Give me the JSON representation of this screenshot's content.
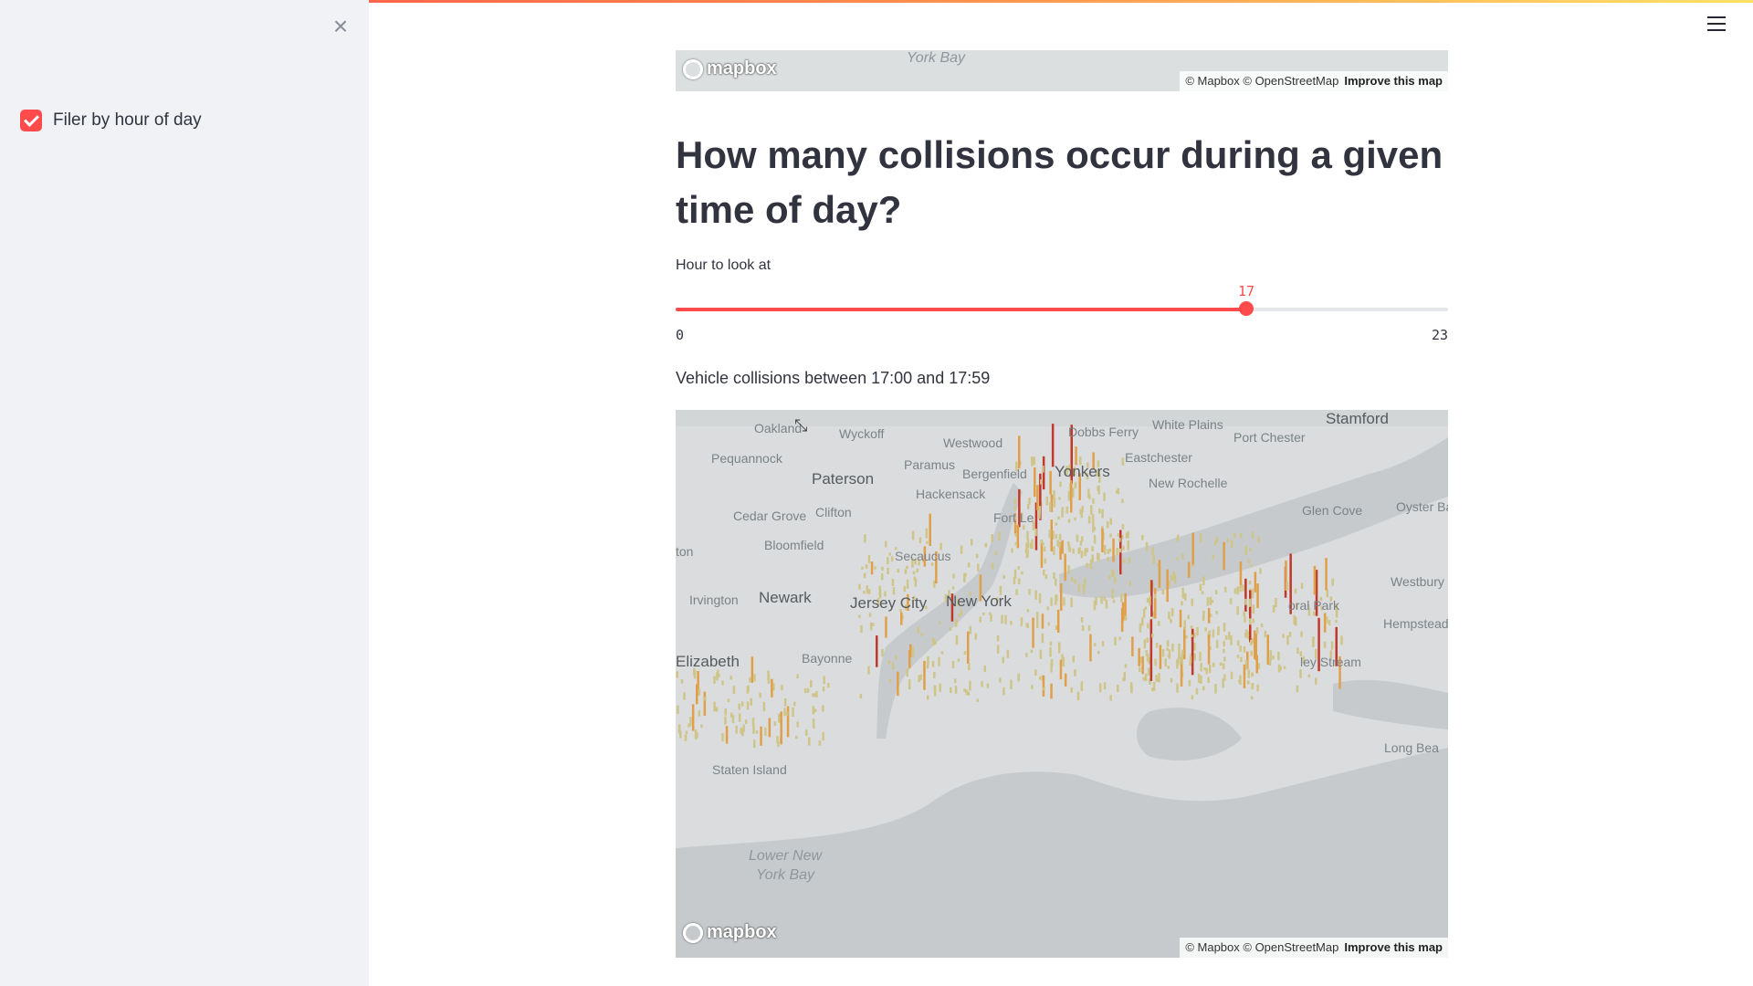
{
  "sidebar": {
    "close_icon": "×",
    "filter_checkbox": {
      "label": "Filer by hour of day",
      "checked": true
    }
  },
  "header": {
    "menu_icon": "hamburger-icon"
  },
  "top_map": {
    "bay_label": "York Bay",
    "logo": "mapbox",
    "attribution": "© Mapbox © OpenStreetMap",
    "improve": "Improve this map"
  },
  "main": {
    "title": "How many collisions occur during a given time of day?",
    "slider": {
      "label": "Hour to look at",
      "value": 17,
      "min": 0,
      "max": 23,
      "value_text": "17",
      "min_text": "0",
      "max_text": "23"
    },
    "caption": "Vehicle collisions between 17:00 and 17:59"
  },
  "map": {
    "logo": "mapbox",
    "attribution": "© Mapbox © OpenStreetMap",
    "improve": "Improve this map",
    "labels": {
      "oakland": "Oakland",
      "wyckoff": "Wyckoff",
      "westwood": "Westwood",
      "dobbs_ferry": "Dobbs Ferry",
      "white_plains": "White Plains",
      "stamford": "Stamford",
      "port_chester": "Port Chester",
      "pequannock": "Pequannock",
      "paramus": "Paramus",
      "bergenfield": "Bergenfield",
      "yonkers": "Yonkers",
      "eastchester": "Eastchester",
      "paterson": "Paterson",
      "hackensack": "Hackensack",
      "new_rochelle": "New Rochelle",
      "glen_cove": "Glen Cove",
      "oyster_bay": "Oyster Ba",
      "cedar_grove": "Cedar Grove",
      "clifton": "Clifton",
      "fort_lee": "Fort Le",
      "bloomfield": "Bloomfield",
      "secaucus": "Secaucus",
      "ton": "ton",
      "westbury": "Westbury",
      "irvington": "Irvington",
      "newark": "Newark",
      "jersey_city": "Jersey City",
      "new_york": "New York",
      "floral_park": "oral Park",
      "hempstead": "Hempstead",
      "elizabeth": "Elizabeth",
      "bayonne": "Bayonne",
      "valley_stream": "ley Stream",
      "staten_island": "Staten Island",
      "long_beach": "Long Bea",
      "lower_bay_1": "Lower New",
      "lower_bay_2": "York Bay"
    },
    "layer_colors": {
      "low": "#cfc58a",
      "mid": "#e0a04a",
      "high": "#c0392b"
    }
  },
  "colors": {
    "accent": "#ff4b4b",
    "sidebar_bg": "#f0f2f6",
    "map_land": "#dadcdd",
    "map_water": "#c6cacd"
  }
}
